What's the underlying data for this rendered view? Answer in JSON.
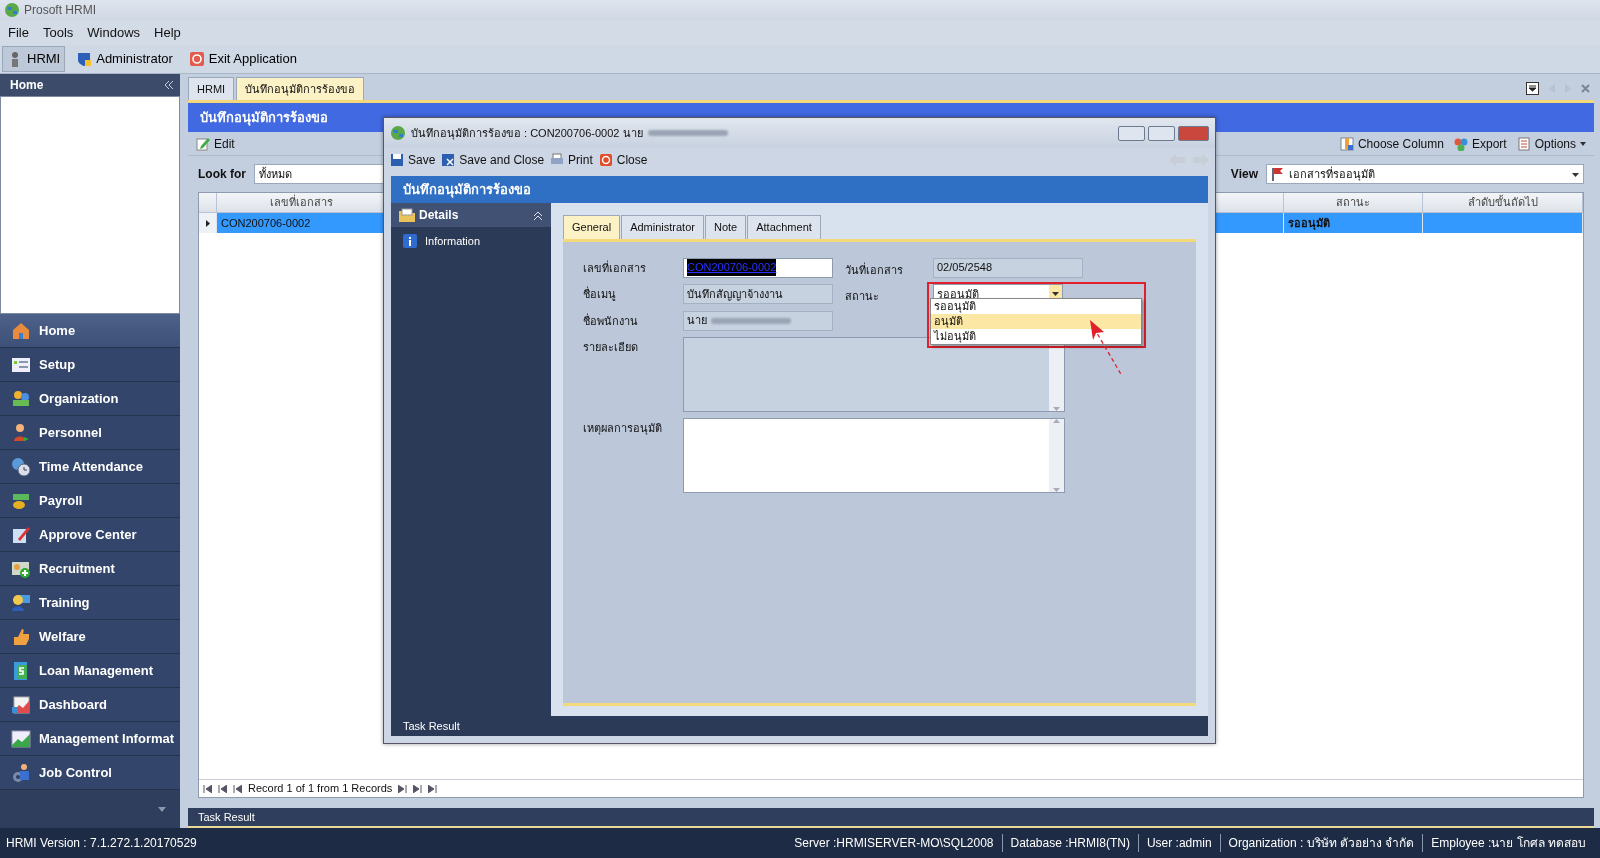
{
  "window": {
    "title": "Prosoft HRMI"
  },
  "menu": [
    "File",
    "Tools",
    "Windows",
    "Help"
  ],
  "toolbar": [
    {
      "label": "HRMI",
      "selected": true
    },
    {
      "label": "Administrator",
      "selected": false
    },
    {
      "label": "Exit Application",
      "selected": false
    }
  ],
  "sidebar": {
    "title": "Home",
    "items": [
      {
        "label": "Home",
        "selected": true
      },
      {
        "label": "Setup",
        "selected": false
      },
      {
        "label": "Organization",
        "selected": false
      },
      {
        "label": "Personnel",
        "selected": false
      },
      {
        "label": "Time Attendance",
        "selected": false
      },
      {
        "label": "Payroll",
        "selected": false
      },
      {
        "label": "Approve Center",
        "selected": false
      },
      {
        "label": "Recruitment",
        "selected": false
      },
      {
        "label": "Training",
        "selected": false
      },
      {
        "label": "Welfare",
        "selected": false
      },
      {
        "label": "Loan Management",
        "selected": false
      },
      {
        "label": "Dashboard",
        "selected": false
      },
      {
        "label": "Management Informat",
        "selected": false
      },
      {
        "label": "Job Control",
        "selected": false
      }
    ]
  },
  "doc_tabs": [
    {
      "label": "HRMI",
      "selected": false
    },
    {
      "label": "บันทึกอนุมัติการร้องขอ",
      "selected": true
    }
  ],
  "page": {
    "title": "บันทึกอนุมัติการร้องขอ",
    "actions": [
      "Edit"
    ],
    "right_actions": [
      "Choose Column",
      "Export",
      "Options"
    ],
    "look_for": {
      "label": "Look for",
      "value": "ทั้งหมด"
    },
    "view": {
      "label": "View",
      "value": "เอกสารที่รออนุมัติ"
    }
  },
  "grid": {
    "columns": [
      "เลขที่เอกสาร",
      "สถานะ",
      "ลำดับขั้นถัดไป"
    ],
    "rows": [
      {
        "selected": true,
        "cells": [
          "CON200706-0002",
          "รออนุมัติ"
        ]
      }
    ],
    "navigator": "Record 1 of 1 from 1 Records"
  },
  "task_result": "Task Result",
  "status_bar": {
    "version": "HRMI Version : 7.1.272.1.20170529",
    "items": [
      "Server :HRMISERVER-MO\\SQL2008",
      "Database :HRMI8(TN)",
      "User :admin",
      "Organization : บริษัท ตัวอย่าง จำกัด",
      "Employee :นาย โกศล ทดสอบ"
    ]
  },
  "dialog": {
    "title": "บันทึกอนุมัติการร้องขอ : CON200706-0002 นาย",
    "toolbar": [
      "Save",
      "Save and Close",
      "Print",
      "Close"
    ],
    "header": "บันทึกอนุมัติการร้องขอ",
    "nav": {
      "title": "Details",
      "items": [
        "Information"
      ]
    },
    "tabs": [
      {
        "label": "General",
        "selected": true
      },
      {
        "label": "Administrator",
        "selected": false
      },
      {
        "label": "Note",
        "selected": false
      },
      {
        "label": "Attachment",
        "selected": false
      }
    ],
    "form_rows": [
      [
        {
          "label": "เลขที่เอกสาร",
          "kind": "input",
          "readonly": false,
          "value": "CON200706-0002",
          "text_selected": true
        },
        {
          "label": "วันที่เอกสาร",
          "kind": "input",
          "readonly": true,
          "value": "02/05/2548"
        }
      ],
      [
        {
          "label": "ชื่อเมนู",
          "kind": "input",
          "readonly": true,
          "value": "บันทึกสัญญาจ้างงาน"
        },
        {
          "label": "สถานะ",
          "kind": "combo",
          "value": "รออนุมัติ"
        }
      ],
      [
        {
          "label": "ชื่อพนักงาน",
          "kind": "input",
          "readonly": true,
          "value": "นาย",
          "blurred": true
        }
      ],
      [
        {
          "label": "รายละเอียด",
          "kind": "memo",
          "readonly": true
        }
      ],
      [
        {
          "label": "เหตุผลการอนุมัติ",
          "kind": "memo",
          "readonly": false
        }
      ]
    ],
    "status_options": [
      {
        "label": "รออนุมัติ",
        "selected": false
      },
      {
        "label": "อนุมัติ",
        "selected": true
      },
      {
        "label": "ไม่อนุมัติ",
        "selected": false
      }
    ],
    "task_result": "Task Result"
  }
}
